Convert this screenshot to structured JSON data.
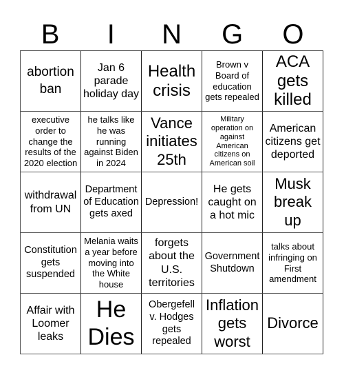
{
  "header": {
    "letters": [
      "B",
      "I",
      "N",
      "G",
      "O"
    ]
  },
  "board": {
    "rows": [
      [
        {
          "text": "abortion ban"
        },
        {
          "text": "Jan 6 parade holiday day"
        },
        {
          "text": "Health crisis"
        },
        {
          "text": "Brown v Board of education gets repealed"
        },
        {
          "text": "ACA gets killed"
        }
      ],
      [
        {
          "text": "executive order to change the results of the 2020 election"
        },
        {
          "text": "he talks like he was running against Biden in 2024"
        },
        {
          "text": "Vance initiates 25th"
        },
        {
          "text": "Military operation on against American citizens on American soil"
        },
        {
          "text": "American citizens get deported"
        }
      ],
      [
        {
          "text": "withdrawal from UN"
        },
        {
          "text": "Department of Education gets axed"
        },
        {
          "text": "Depression!"
        },
        {
          "text": "He gets caught on a hot mic"
        },
        {
          "text": "Musk break up"
        }
      ],
      [
        {
          "text": "Constitution gets suspended"
        },
        {
          "text": "Melania waits a year before moving into the White house"
        },
        {
          "text": "forgets about the U.S. territories"
        },
        {
          "text": "Government Shutdown"
        },
        {
          "text": "talks about infringing on First amendment"
        }
      ],
      [
        {
          "text": "Affair with Loomer leaks"
        },
        {
          "text": "He Dies"
        },
        {
          "text": "Obergefell v. Hodges gets repealed"
        },
        {
          "text": "Inflation gets worst"
        },
        {
          "text": "Divorce"
        }
      ]
    ]
  }
}
